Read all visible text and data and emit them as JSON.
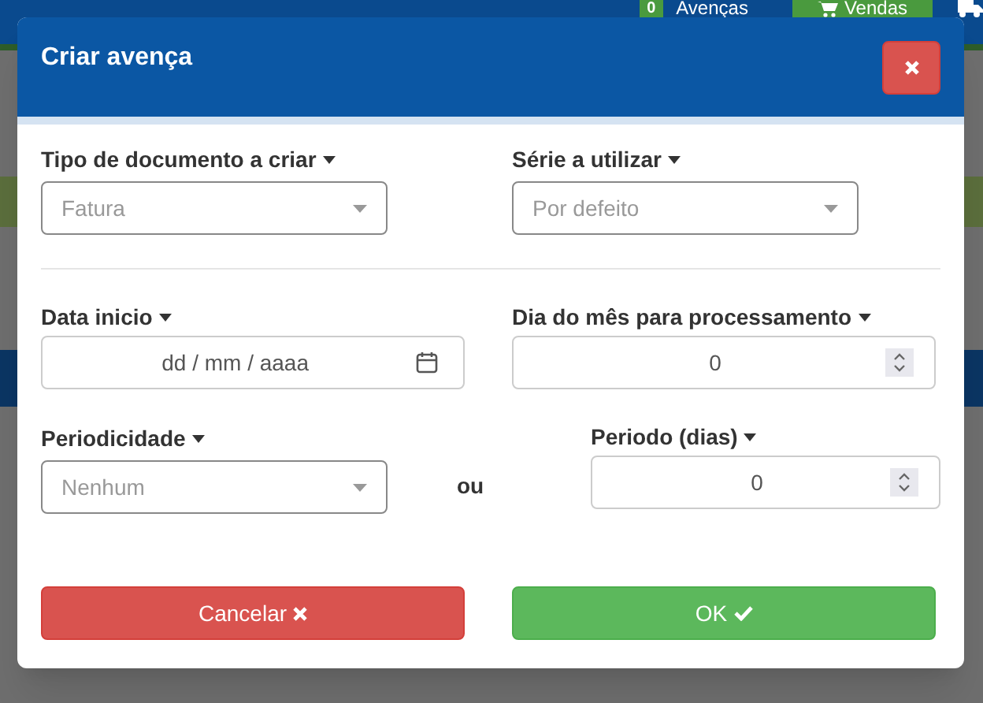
{
  "background_nav": {
    "badge": "0",
    "links": [
      {
        "label": "Avenças",
        "kind": "text"
      },
      {
        "label": "Vendas",
        "kind": "cart"
      },
      {
        "kind": "truck"
      }
    ]
  },
  "dialog": {
    "title": "Criar avença",
    "fields": [
      {
        "label": "Tipo de documento a criar",
        "kind": "select",
        "placeholder": "Fatura"
      },
      {
        "label": "Série a utilizar",
        "kind": "select",
        "placeholder": "Por defeito"
      },
      {
        "label": "Data inicio",
        "kind": "date",
        "value": "dd / mm / aaaa"
      },
      {
        "label": "Dia do mês para processamento",
        "kind": "number",
        "value": "0"
      },
      {
        "label": "Periodicidade",
        "kind": "select",
        "placeholder": "Nenhum"
      },
      {
        "label": "Periodo (dias)",
        "kind": "number",
        "value": "0"
      }
    ],
    "separator": "ou",
    "buttons": [
      {
        "label": "Cancelar",
        "kind": "cancel"
      },
      {
        "label": "OK",
        "kind": "ok"
      }
    ]
  }
}
